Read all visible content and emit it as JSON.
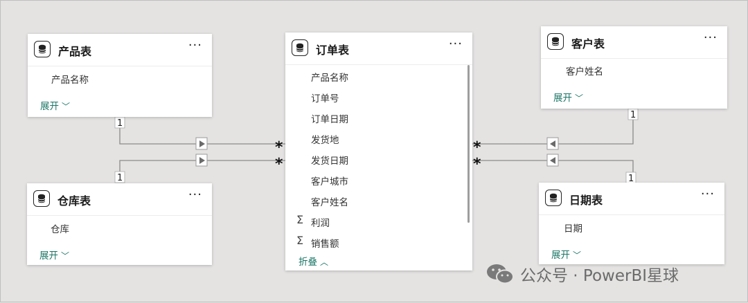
{
  "tables": {
    "product": {
      "title": "产品表",
      "fields": [
        "产品名称"
      ],
      "toggle": "展开"
    },
    "warehouse": {
      "title": "仓库表",
      "fields": [
        "仓库"
      ],
      "toggle": "展开"
    },
    "orders": {
      "title": "订单表",
      "fields": [
        "产品名称",
        "订单号",
        "订单日期",
        "发货地",
        "发货日期",
        "客户城市",
        "客户姓名"
      ],
      "measures": [
        "利润",
        "销售额"
      ],
      "toggle": "折叠"
    },
    "customer": {
      "title": "客户表",
      "fields": [
        "客户姓名"
      ],
      "toggle": "展开"
    },
    "date": {
      "title": "日期表",
      "fields": [
        "日期"
      ],
      "toggle": "展开"
    }
  },
  "relationships": {
    "one": "1",
    "many": "*"
  },
  "icons": {
    "table": "database-icon",
    "more": "more-options-icon",
    "measure": "sigma-icon",
    "expand": "chevron-down-icon",
    "collapse": "chevron-up-icon",
    "direction": "triangle-arrow-icon"
  },
  "watermark": {
    "text": "公众号 · PowerBI星球"
  },
  "colors": {
    "canvas": "#e4e3e2",
    "card": "#ffffff",
    "accent": "#1a7566",
    "line": "#8a8a8a"
  }
}
